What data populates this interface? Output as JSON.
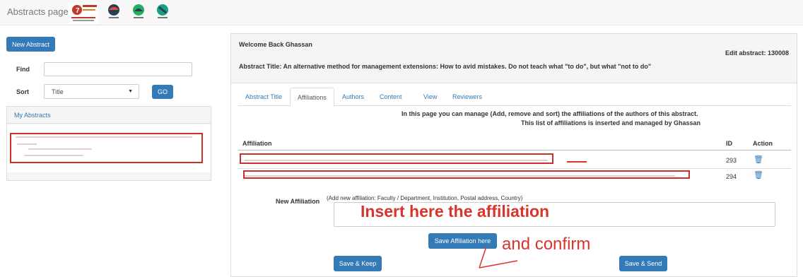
{
  "header": {
    "brand": "Abstracts page",
    "logo_text": "7th MEDITERRANEAN POULTRY SUMMIT"
  },
  "left": {
    "new_abstract_label": "New Abstract",
    "find_label": "Find",
    "find_value": "",
    "sort_label": "Sort",
    "sort_selected": "Title",
    "go_label": "GO",
    "my_abstracts_label": "My Abstracts"
  },
  "main": {
    "welcome": "Welcome Back Ghassan",
    "edit_abstract": "Edit abstract: 130008",
    "abstract_title": "Abstract Title: An alternative method for management extensions: How to avid mistakes. Do not teach what \"to do\", but what \"not to do\"",
    "tabs": [
      {
        "label": "Abstract Title",
        "active": false
      },
      {
        "label": "Affiliations",
        "active": true
      },
      {
        "label": "Authors",
        "active": false
      },
      {
        "label": "Content",
        "active": false
      },
      {
        "label": "View",
        "active": false
      },
      {
        "label": "Reviewers",
        "active": false
      }
    ],
    "info_line1": "In this page you can manage (Add, remove and sort) the affiliations of the authors of this abstract.",
    "info_line2": "This list of affiliations is inserted and managed by Ghassan",
    "table": {
      "headers": [
        "Affiliation",
        "ID",
        "Action"
      ],
      "rows": [
        {
          "id": "293"
        },
        {
          "id": "294"
        }
      ]
    },
    "new_affiliation_label": "New Affiliation",
    "new_affiliation_hint": "(Add new affiliation: Faculty / Department, Institution, Postal address, Country)",
    "new_affiliation_value": "",
    "save_affiliation_label": "Save Affiliation here",
    "save_keep_label": "Save & Keep",
    "save_send_label": "Save & Send"
  },
  "annotations": {
    "insert_here": "Insert here the affiliation",
    "confirm": "and confirm"
  },
  "colors": {
    "primary": "#337ab7",
    "annotation_red": "#d9342b"
  }
}
